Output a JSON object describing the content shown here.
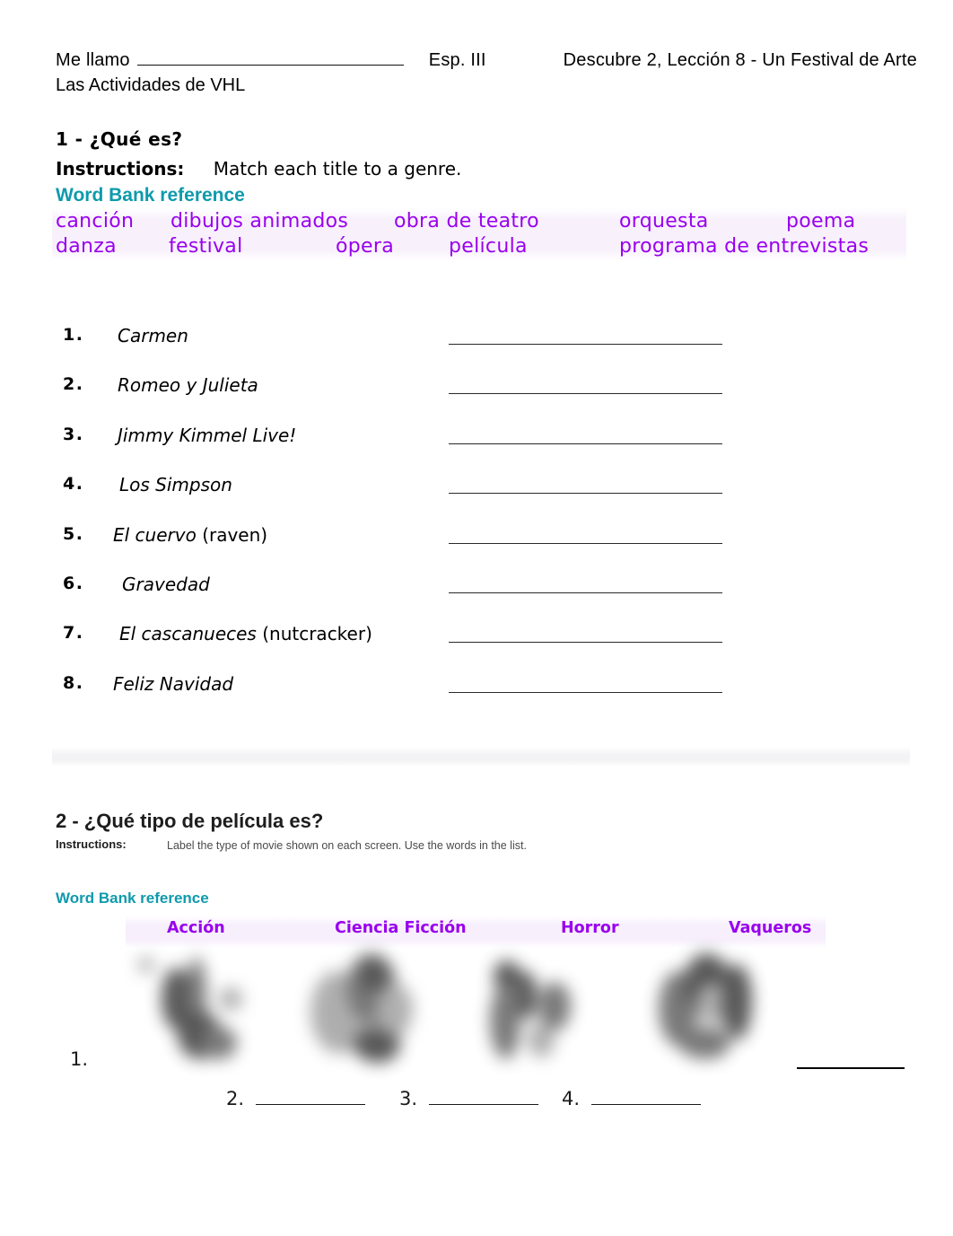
{
  "header": {
    "name_label": "Me llamo",
    "course": "Esp. III",
    "lesson": "Descubre 2, Lección 8 - Un Festival de Arte",
    "subtitle": "Las Actividades de VHL"
  },
  "section1": {
    "title": "1 - ¿Qué es?",
    "instructions_label": "Instructions:",
    "instructions_text": "Match each title to a genre.",
    "word_bank_title": "Word Bank reference",
    "word_bank_row1": [
      "canción",
      "dibujos animados",
      "obra de teatro",
      "orquesta",
      "poema"
    ],
    "word_bank_row2": [
      "danza",
      "festival",
      "ópera",
      "película",
      "programa de entrevistas"
    ],
    "items": [
      {
        "num": "1.",
        "title": "Carmen",
        "gloss": ""
      },
      {
        "num": "2.",
        "title": "Romeo y Julieta",
        "gloss": ""
      },
      {
        "num": "3.",
        "title": "Jimmy Kimmel Live!",
        "gloss": ""
      },
      {
        "num": "4.",
        "title": "Los Simpson",
        "gloss": ""
      },
      {
        "num": "5.",
        "title": "El cuervo ",
        "gloss": "(raven)"
      },
      {
        "num": "6.",
        "title": "Gravedad",
        "gloss": ""
      },
      {
        "num": "7.",
        "title": "El cascanueces ",
        "gloss": "(nutcracker)"
      },
      {
        "num": "8.",
        "title": "Feliz Navidad",
        "gloss": ""
      }
    ]
  },
  "section2": {
    "title": "2 - ¿Qué tipo de película es?",
    "instructions_label": "Instructions:",
    "instructions_text": "Label the type of movie shown on each screen. Use the words in the list.",
    "word_bank_title": "Word Bank reference",
    "word_bank": [
      "Acción",
      "Ciencia Ficción",
      "Horror",
      "Vaqueros"
    ],
    "answers": [
      {
        "num": "1."
      },
      {
        "num": "2."
      },
      {
        "num": "3."
      },
      {
        "num": "4."
      }
    ]
  },
  "colors": {
    "word_bank_heading": "#0e9aac",
    "word_bank_text": "#9900ee",
    "body_text": "#000000",
    "instructions_gray": "#4a4a4a"
  }
}
